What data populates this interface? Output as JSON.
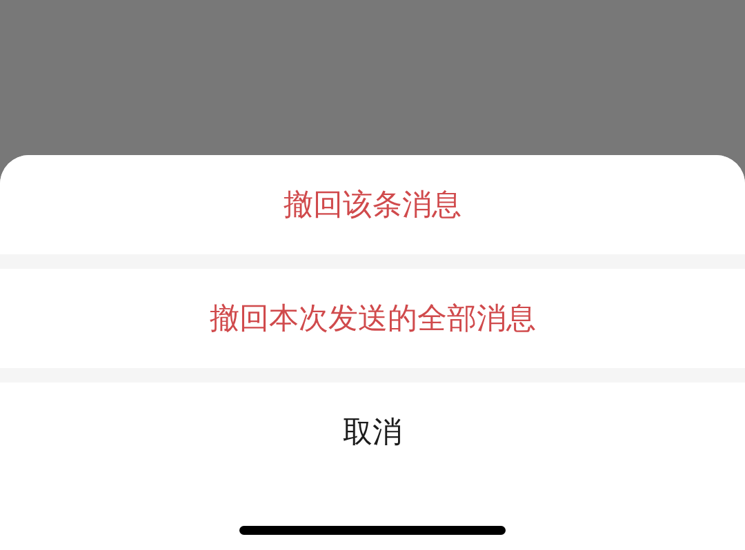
{
  "action_sheet": {
    "items": [
      {
        "label": "撤回该条消息",
        "kind": "destructive"
      },
      {
        "label": "撤回本次发送的全部消息",
        "kind": "destructive"
      },
      {
        "label": "取消",
        "kind": "cancel"
      }
    ]
  }
}
